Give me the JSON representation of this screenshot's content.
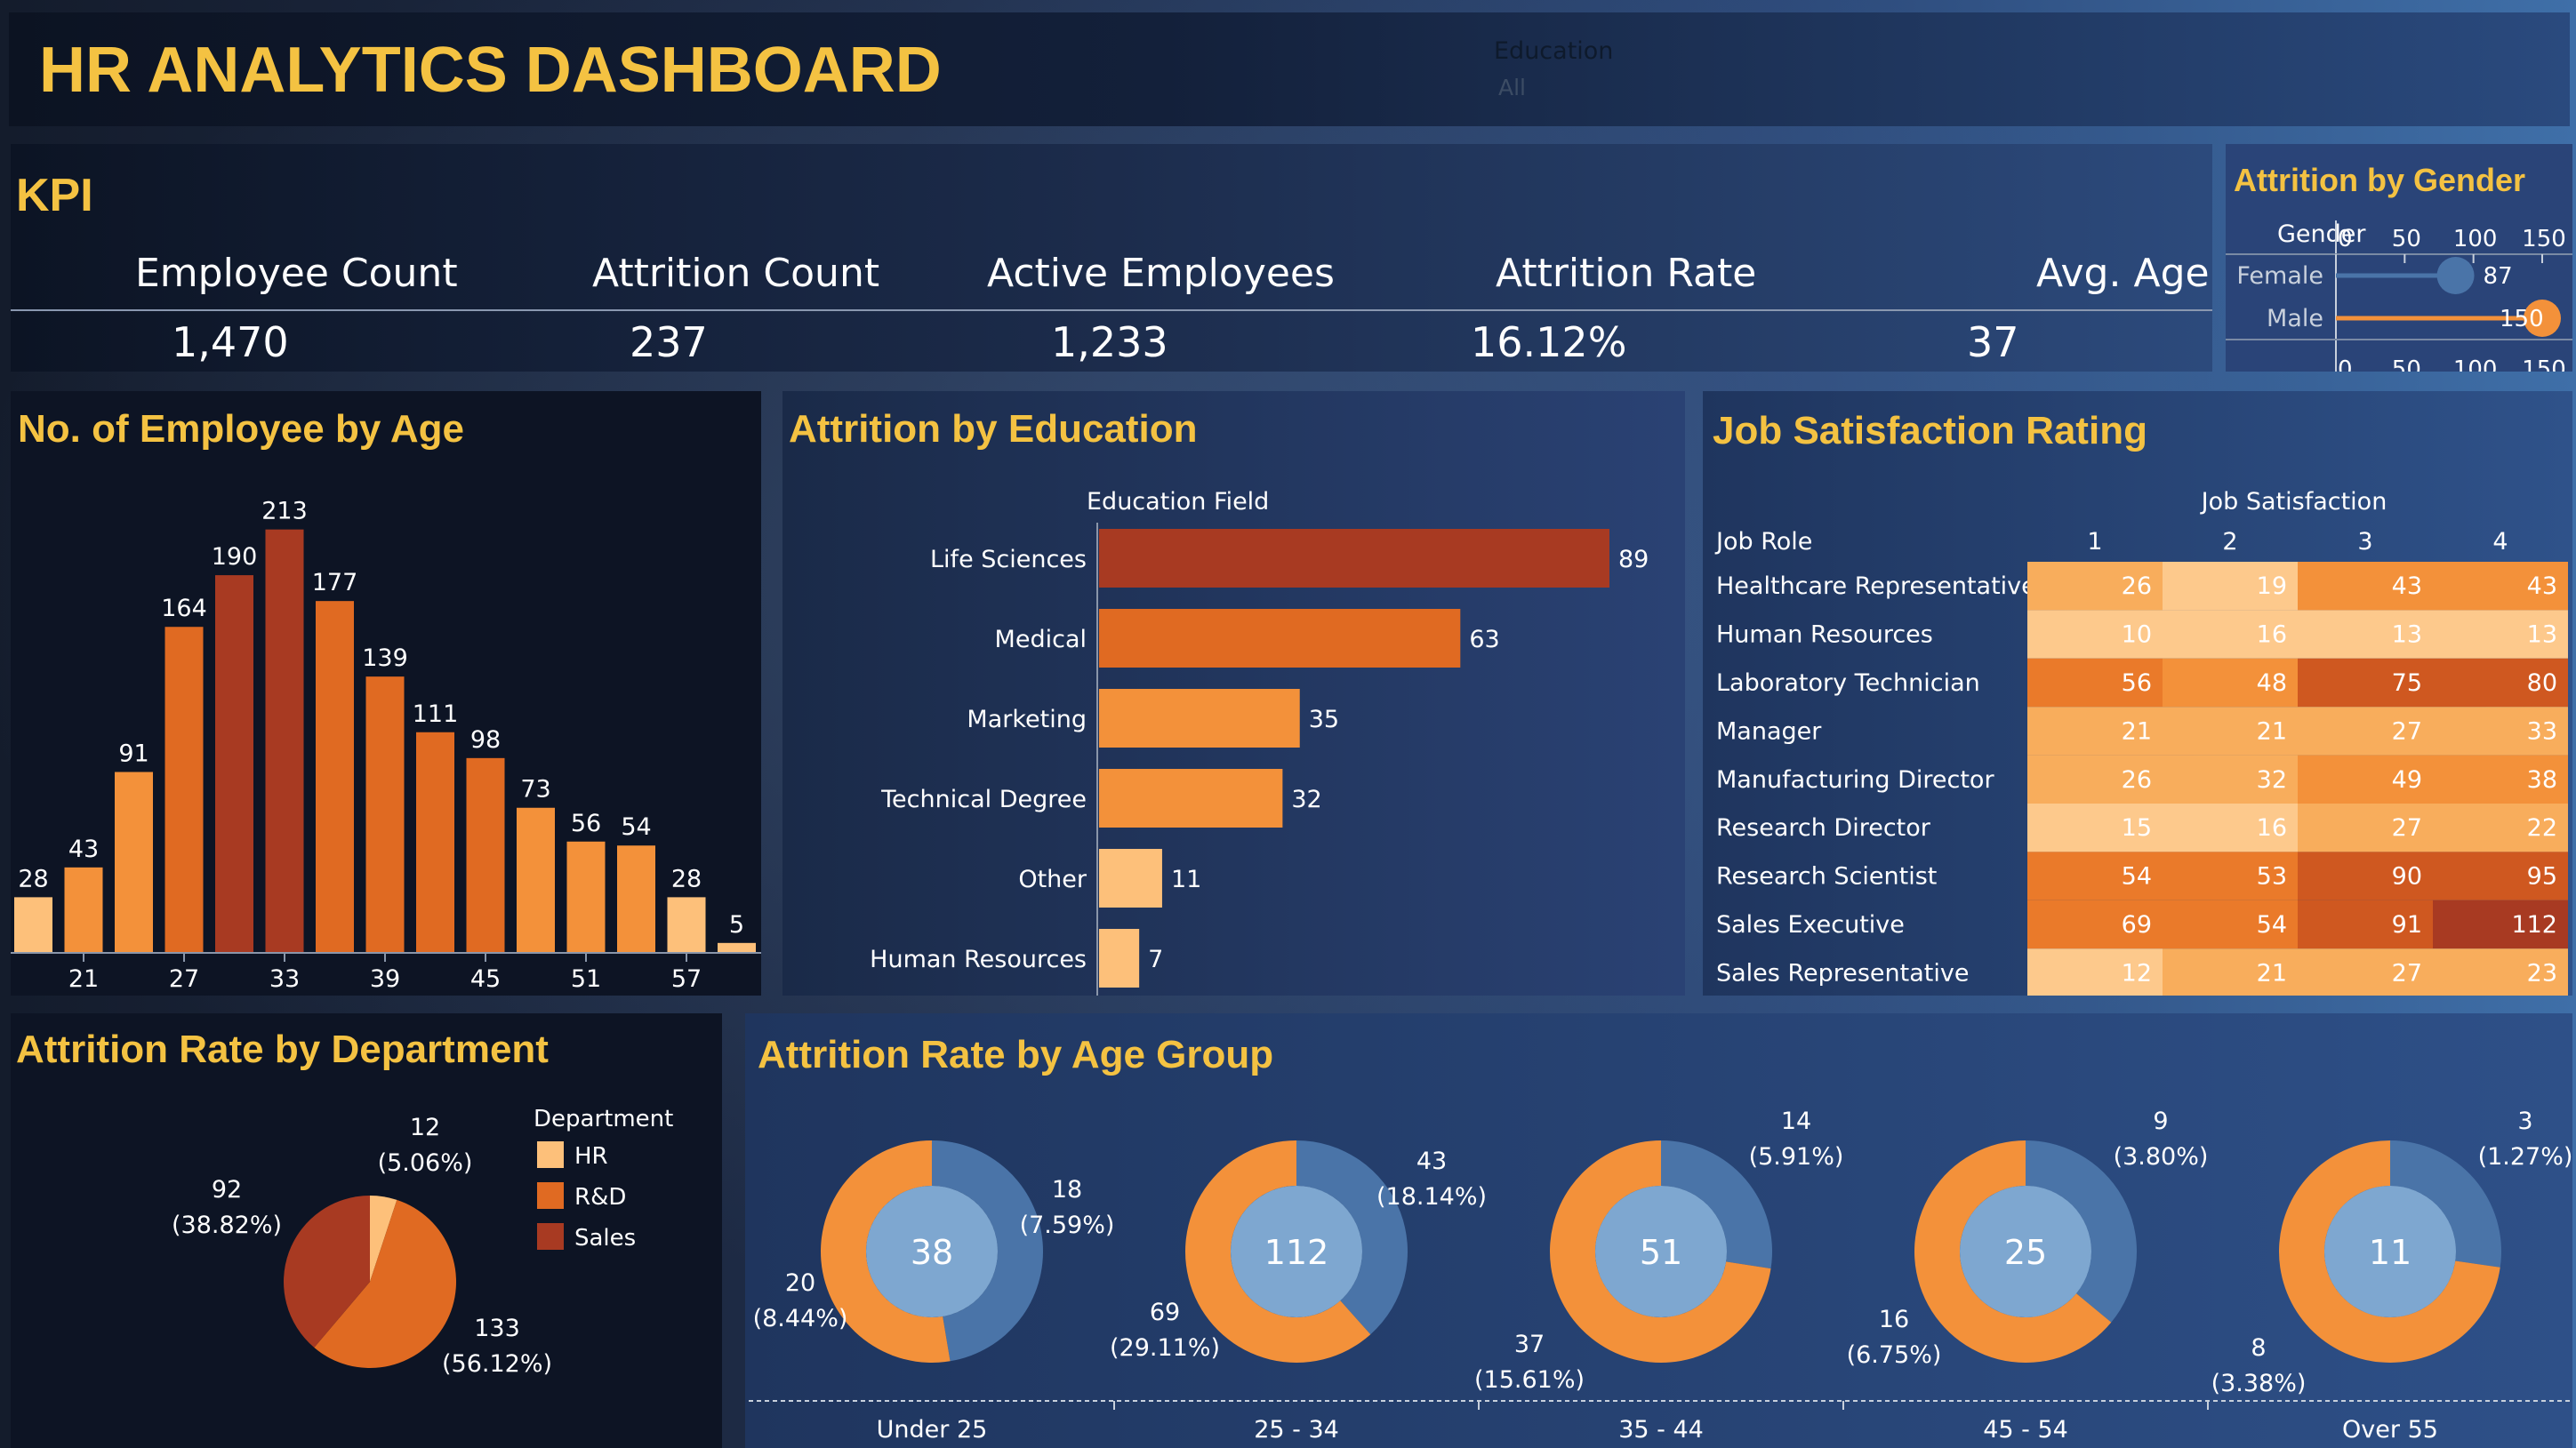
{
  "header": {
    "title": "HR ANALYTICS DASHBOARD",
    "filter_label": "Education",
    "filter_value": "All"
  },
  "kpi": {
    "title": "KPI",
    "items": [
      {
        "label": "Employee Count",
        "value": "1,470"
      },
      {
        "label": "Attrition Count",
        "value": "237"
      },
      {
        "label": "Active Employees",
        "value": "1,233"
      },
      {
        "label": "Attrition Rate",
        "value": "16.12%"
      },
      {
        "label": "Avg. Age",
        "value": "37"
      }
    ]
  },
  "colors": {
    "panel_dark": "#0d1424",
    "panel_blue": "#2a4478",
    "title_yellow": "#f4c242",
    "orange_light": "#fdc07a",
    "orange": "#f3913a",
    "orange_dark": "#e06a22",
    "red_brown": "#a83a22",
    "blue_donut": "#4a74a8",
    "blue_center": "#7ea7d0"
  },
  "chart_data": [
    {
      "type": "scatter",
      "title": "Attrition by Gender",
      "ylabel": "Gender",
      "categories": [
        "Female",
        "Male"
      ],
      "values": [
        87,
        150
      ],
      "xlim": [
        0,
        150
      ],
      "xticks": [
        "0",
        "50",
        "100",
        "150"
      ]
    },
    {
      "type": "bar",
      "title": "No. of Employee by Age",
      "values": [
        28,
        43,
        91,
        164,
        190,
        213,
        177,
        139,
        111,
        98,
        73,
        56,
        54,
        28,
        5
      ],
      "xticks": [
        "21",
        "27",
        "33",
        "39",
        "45",
        "51",
        "57"
      ]
    },
    {
      "type": "bar",
      "title": "Attrition by Education",
      "ylabel": "Education Field",
      "categories": [
        "Life Sciences",
        "Medical",
        "Marketing",
        "Technical Degree",
        "Other",
        "Human Resources"
      ],
      "values": [
        89,
        63,
        35,
        32,
        11,
        7
      ]
    },
    {
      "type": "heatmap",
      "title": "Job Satisfaction Rating",
      "xlabel": "Job Satisfaction",
      "ylabel": "Job Role",
      "columns": [
        "1",
        "2",
        "3",
        "4"
      ],
      "rows": [
        {
          "name": "Healthcare Representative",
          "values": [
            26,
            19,
            43,
            43
          ]
        },
        {
          "name": "Human Resources",
          "values": [
            10,
            16,
            13,
            13
          ]
        },
        {
          "name": "Laboratory Technician",
          "values": [
            56,
            48,
            75,
            80
          ]
        },
        {
          "name": "Manager",
          "values": [
            21,
            21,
            27,
            33
          ]
        },
        {
          "name": "Manufacturing Director",
          "values": [
            26,
            32,
            49,
            38
          ]
        },
        {
          "name": "Research Director",
          "values": [
            15,
            16,
            27,
            22
          ]
        },
        {
          "name": "Research Scientist",
          "values": [
            54,
            53,
            90,
            95
          ]
        },
        {
          "name": "Sales Executive",
          "values": [
            69,
            54,
            91,
            112
          ]
        },
        {
          "name": "Sales Representative",
          "values": [
            12,
            21,
            27,
            23
          ]
        }
      ]
    },
    {
      "type": "pie",
      "title": "Attrition Rate by Department",
      "legend_title": "Department",
      "series": [
        {
          "name": "HR",
          "value": 12,
          "pct": "(5.06%)"
        },
        {
          "name": "R&D",
          "value": 133,
          "pct": "(56.12%)"
        },
        {
          "name": "Sales",
          "value": 92,
          "pct": "(38.82%)"
        }
      ]
    },
    {
      "type": "pie",
      "title": "Attrition Rate by Age Group",
      "groups": [
        {
          "name": "Under 25",
          "center": "38",
          "attrition": {
            "value": 18,
            "pct": "(7.59%)"
          },
          "other": {
            "value": 20,
            "pct": "(8.44%)"
          }
        },
        {
          "name": "25 - 34",
          "center": "112",
          "attrition": {
            "value": 43,
            "pct": "(18.14%)"
          },
          "other": {
            "value": 69,
            "pct": "(29.11%)"
          }
        },
        {
          "name": "35 - 44",
          "center": "51",
          "attrition": {
            "value": 14,
            "pct": "(5.91%)"
          },
          "other": {
            "value": 37,
            "pct": "(15.61%)"
          }
        },
        {
          "name": "45 - 54",
          "center": "25",
          "attrition": {
            "value": 9,
            "pct": "(3.80%)"
          },
          "other": {
            "value": 16,
            "pct": "(6.75%)"
          }
        },
        {
          "name": "Over 55",
          "center": "11",
          "attrition": {
            "value": 3,
            "pct": "(1.27%)"
          },
          "other": {
            "value": 8,
            "pct": "(3.38%)"
          }
        }
      ]
    }
  ]
}
